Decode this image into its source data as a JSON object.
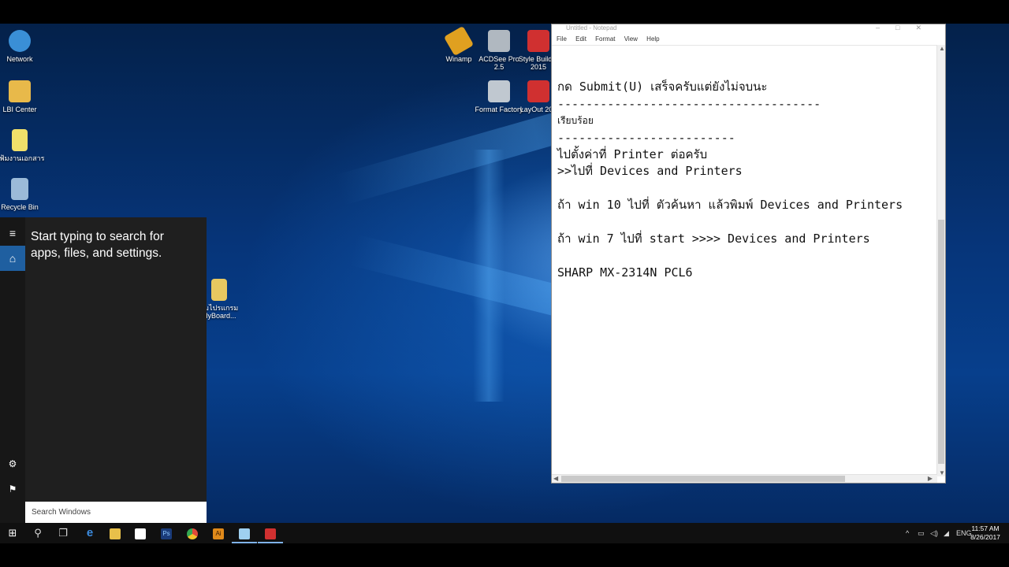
{
  "desktop_icons": [
    {
      "label": "Network",
      "icon": "network-icon",
      "color": "#3a8fd6"
    },
    {
      "label": "LBI Center",
      "icon": "folder-icon",
      "color": "#e8b94a"
    },
    {
      "label": "แฟ้มงานเอกสาร",
      "icon": "document-file-icon",
      "color": "#f0e06a"
    },
    {
      "label": "Recycle Bin",
      "icon": "recycle-bin-icon",
      "color": "#9bbad8"
    },
    {
      "label": "Winamp",
      "icon": "winamp-icon",
      "color": "#e0a020"
    },
    {
      "label": "ACDSee Pro 2.5",
      "icon": "acdsee-icon",
      "color": "#b0b8c0"
    },
    {
      "label": "Style Builder 2015",
      "icon": "style-builder-icon",
      "color": "#d03030"
    },
    {
      "label": "Format Factory",
      "icon": "format-factory-icon",
      "color": "#c0c8d0"
    },
    {
      "label": "LayOut 201",
      "icon": "layout-icon",
      "color": "#d03030"
    },
    {
      "label": "อมไปรแกรม olyBoard...",
      "icon": "file-icon",
      "color": "#e8c860"
    }
  ],
  "notepad": {
    "title": "Untitled - Notepad",
    "menu": [
      "File",
      "Edit",
      "Format",
      "View",
      "Help"
    ],
    "lines": [
      {
        "text": "",
        "small": false
      },
      {
        "text": "กด Submit(U) เสร็จครับแต่ยังไม่จบนะ",
        "small": false
      },
      {
        "text": "-------------------------------------",
        "small": false
      },
      {
        "text": "เรียบร้อย",
        "small": true
      },
      {
        "text": "-------------------------",
        "small": false
      },
      {
        "text": "ไปตั้งค่าที่ Printer ต่อครับ",
        "small": false
      },
      {
        "text": ">>ไปที่ Devices and Printers",
        "small": false
      },
      {
        "text": "",
        "small": false
      },
      {
        "text": "ถ้า win 10 ไปที่ ตัวค้นหา แล้วพิมพ์ Devices and Printers",
        "small": false
      },
      {
        "text": "",
        "small": false
      },
      {
        "text": "ถ้า win 7 ไปที่ start >>>> Devices and Printers",
        "small": false
      },
      {
        "text": "",
        "small": false
      },
      {
        "text": "SHARP MX-2314N PCL6",
        "small": false
      }
    ]
  },
  "start_menu": {
    "hint": "Start typing to search for apps, files, and settings.",
    "search_value": "Search Windows",
    "rail": [
      {
        "name": "hamburger-menu-icon",
        "glyph": "≡"
      },
      {
        "name": "home-icon",
        "glyph": "⌂"
      },
      {
        "name": "settings-gear-icon",
        "glyph": "⚙"
      },
      {
        "name": "feedback-icon",
        "glyph": "⚑"
      }
    ]
  },
  "taskbar": {
    "buttons": [
      {
        "name": "start-button",
        "glyph": "⊞",
        "color": "#ffffff"
      },
      {
        "name": "search-button",
        "glyph": "⚲",
        "color": "#ffffff"
      },
      {
        "name": "task-view-button",
        "glyph": "❐",
        "color": "#ffffff"
      },
      {
        "name": "edge-button",
        "glyph": "e",
        "color": "#3c8ce0"
      },
      {
        "name": "file-explorer-button",
        "glyph": "",
        "color": "#e8c04a"
      },
      {
        "name": "store-button",
        "glyph": "",
        "color": "#ffffff"
      },
      {
        "name": "photoshop-button",
        "glyph": "Ps",
        "color": "#1a3b7a"
      },
      {
        "name": "chrome-button",
        "glyph": "",
        "color": "#e04a3a"
      },
      {
        "name": "illustrator-button",
        "glyph": "Ai",
        "color": "#e08a1a"
      },
      {
        "name": "notepad-button",
        "glyph": "",
        "color": "#9fd0f0"
      },
      {
        "name": "sketchup-button",
        "glyph": "",
        "color": "#d03030"
      }
    ],
    "tray": {
      "chevron": "^",
      "language": "ENG",
      "time": "11:57 AM",
      "date": "8/26/2017"
    }
  }
}
